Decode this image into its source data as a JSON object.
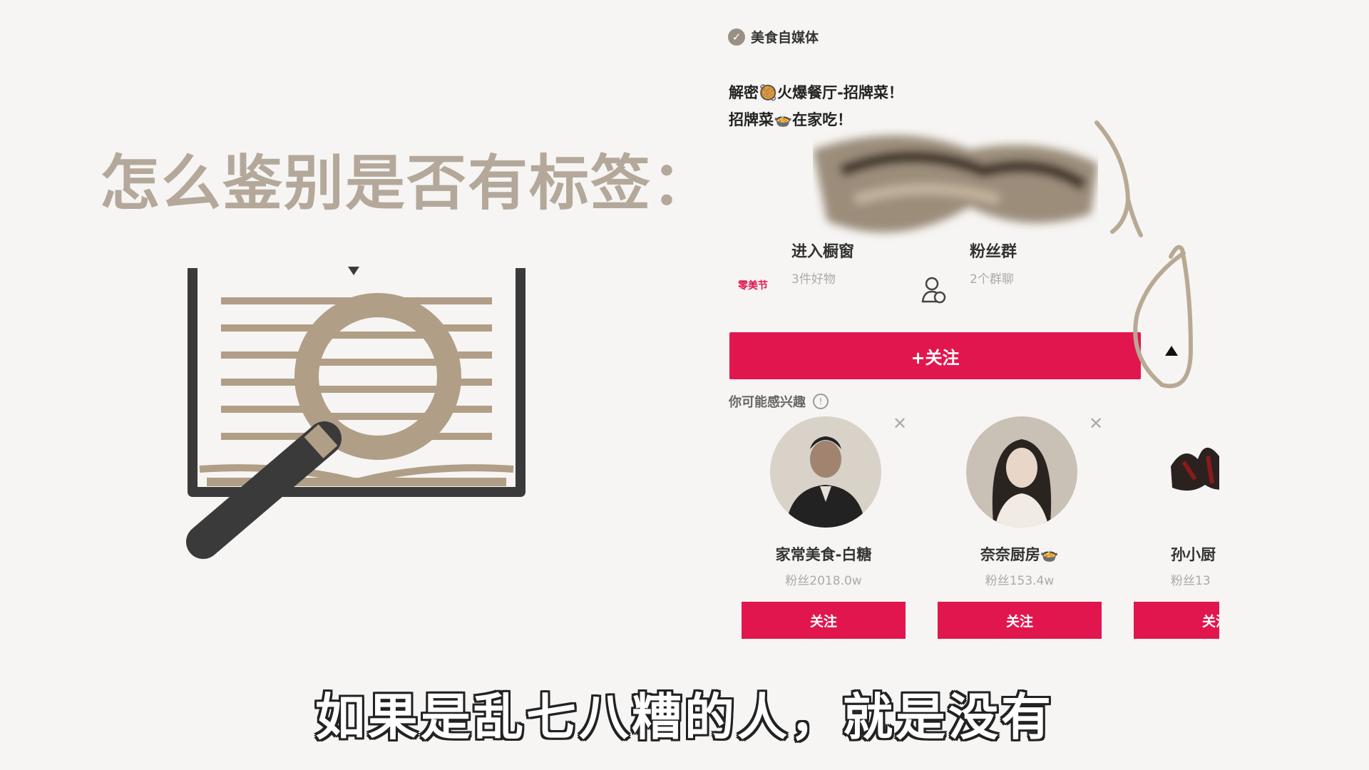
{
  "slide": {
    "title": "怎么鉴别是否有标签："
  },
  "profile": {
    "verified_label": "美食自媒体",
    "desc_line1": "解密🥘火爆餐厅-招牌菜！",
    "desc_line2": "招牌菜🍲在家吃！",
    "shop_badge": "零美节",
    "shop_title": "进入橱窗",
    "shop_sub": "3件好物",
    "fans_group_title": "粉丝群",
    "fans_group_sub": "2个群聊",
    "follow_label": "+关注",
    "interest_label": "你可能感兴趣",
    "icons": [
      "verified-icon",
      "group-icon",
      "info-icon",
      "close-icon",
      "more-arrow-icon"
    ]
  },
  "recommendations": [
    {
      "name": "家常美食-白糖",
      "fans": "粉丝2018.0w",
      "follow": "关注"
    },
    {
      "name": "奈奈厨房🍲",
      "fans": "粉丝153.4w",
      "follow": "关注"
    },
    {
      "name": "孙小厨",
      "fans": "粉丝13",
      "follow": "关注"
    }
  ],
  "subtitle": "如果是乱七八糟的人，就是没有",
  "colors": {
    "accent": "#e2164e",
    "title": "#b4a89b",
    "art_brown": "#b09e86",
    "art_dark": "#3a3a3a"
  }
}
